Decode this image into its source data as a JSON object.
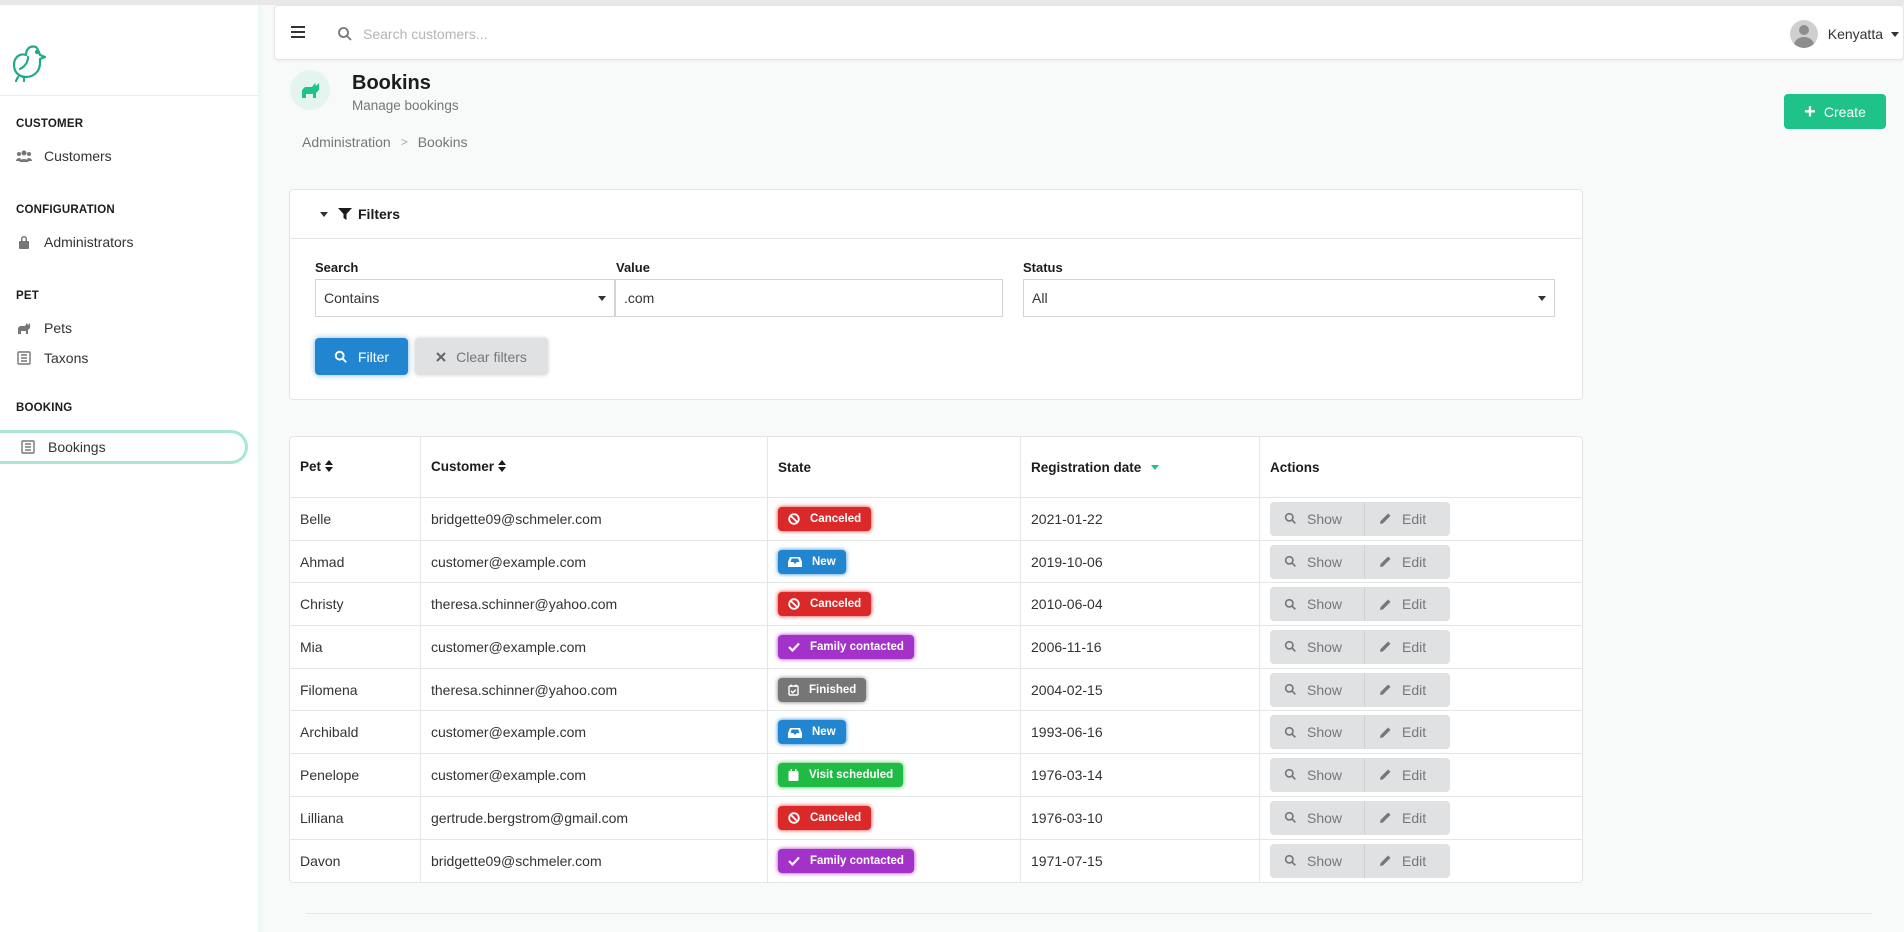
{
  "sidebar": {
    "sections": [
      {
        "title": "CUSTOMER",
        "items": [
          {
            "label": "Customers",
            "icon": "users-icon"
          }
        ]
      },
      {
        "title": "CONFIGURATION",
        "items": [
          {
            "label": "Administrators",
            "icon": "lock-icon"
          }
        ]
      },
      {
        "title": "PET",
        "items": [
          {
            "label": "Pets",
            "icon": "cat-icon"
          },
          {
            "label": "Taxons",
            "icon": "list-icon"
          }
        ]
      },
      {
        "title": "BOOKING",
        "items": [
          {
            "label": "Bookings",
            "icon": "list-icon",
            "active": true
          }
        ]
      }
    ]
  },
  "topbar": {
    "search_placeholder": "Search customers...",
    "user_name": "Kenyatta"
  },
  "header": {
    "title": "Bookins",
    "subtitle": "Manage bookings",
    "breadcrumb": [
      "Administration",
      "Bookins"
    ],
    "create_label": "Create"
  },
  "filters": {
    "title": "Filters",
    "search_label": "Search",
    "search_value": "Contains",
    "value_label": "Value",
    "value_value": ".com",
    "status_label": "Status",
    "status_value": "All",
    "filter_label": "Filter",
    "clear_label": "Clear filters"
  },
  "table": {
    "headers": {
      "pet": "Pet",
      "customer": "Customer",
      "state": "State",
      "registration_date": "Registration date",
      "actions": "Actions"
    },
    "show_label": "Show",
    "edit_label": "Edit",
    "rows": [
      {
        "pet": "Belle",
        "customer": "bridgette09@schmeler.com",
        "state": "Canceled",
        "date": "2021-01-22"
      },
      {
        "pet": "Ahmad",
        "customer": "customer@example.com",
        "state": "New",
        "date": "2019-10-06"
      },
      {
        "pet": "Christy",
        "customer": "theresa.schinner@yahoo.com",
        "state": "Canceled",
        "date": "2010-06-04"
      },
      {
        "pet": "Mia",
        "customer": "customer@example.com",
        "state": "Family contacted",
        "date": "2006-11-16"
      },
      {
        "pet": "Filomena",
        "customer": "theresa.schinner@yahoo.com",
        "state": "Finished",
        "date": "2004-02-15"
      },
      {
        "pet": "Archibald",
        "customer": "customer@example.com",
        "state": "New",
        "date": "1993-06-16"
      },
      {
        "pet": "Penelope",
        "customer": "customer@example.com",
        "state": "Visit scheduled",
        "date": "1976-03-14"
      },
      {
        "pet": "Lilliana",
        "customer": "gertrude.bergstrom@gmail.com",
        "state": "Canceled",
        "date": "1976-03-10"
      },
      {
        "pet": "Davon",
        "customer": "bridgette09@schmeler.com",
        "state": "Family contacted",
        "date": "1971-07-15"
      }
    ]
  },
  "colors": {
    "brand": "#1fc38a",
    "primary": "#2185d0",
    "canceled": "#db2828",
    "new": "#2185d0",
    "family_contacted": "#a333c8",
    "finished": "#767676",
    "visit_scheduled": "#21ba45"
  }
}
